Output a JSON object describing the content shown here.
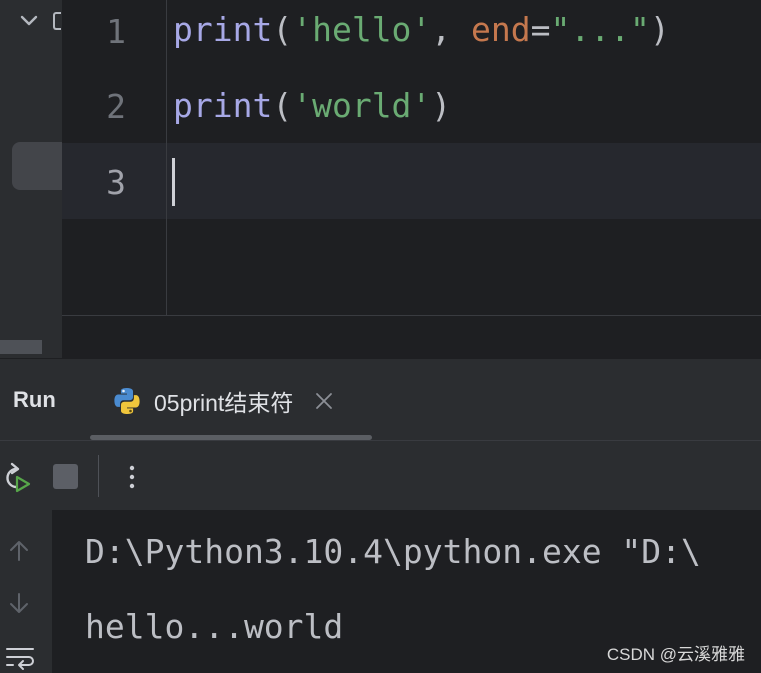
{
  "editor": {
    "line_numbers": [
      "1",
      "2",
      "3"
    ],
    "line1": {
      "fn": "print",
      "open": "(",
      "str1": "'hello'",
      "comma": ", ",
      "kw": "end",
      "eq": "=",
      "str2": "\"...\"",
      "close": ")"
    },
    "line2": {
      "fn": "print",
      "open": "(",
      "str1": "'world'",
      "close": ")"
    },
    "current_line": 3
  },
  "run_panel": {
    "title": "Run",
    "tab": {
      "label": "05print结束符",
      "icon": "python-icon"
    },
    "toolbar": {
      "icons": [
        "rerun-icon",
        "stop-icon",
        "more-icon"
      ]
    },
    "console_gutter_icons": [
      "arrow-up-icon",
      "arrow-down-icon",
      "soft-wrap-icon"
    ],
    "output": [
      "D:\\Python3.10.4\\python.exe \"D:\\",
      "hello...world"
    ]
  },
  "watermark": "CSDN @云溪雅雅",
  "colors": {
    "background": "#1e1f22",
    "panel": "#2b2d30",
    "function": "#a7a8e6",
    "string": "#6aab73",
    "keyword": "#c5784e",
    "text": "#bcbec4"
  }
}
